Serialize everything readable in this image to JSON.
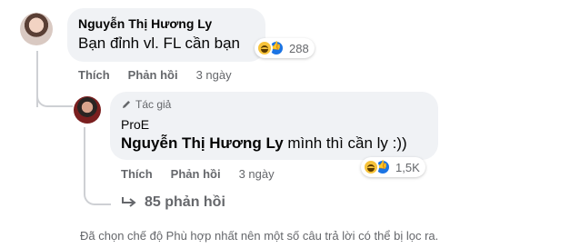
{
  "comment": {
    "author": "Nguyễn Thị Hương Ly",
    "text": "Bạn đỉnh vl. FL cần bạn",
    "reaction_count": "288",
    "actions": {
      "like": "Thích",
      "reply": "Phản hồi"
    },
    "time": "3 ngày"
  },
  "reply": {
    "badge": "Tác giả",
    "author": "ProE",
    "mention": "Nguyễn Thị Hương Ly",
    "text": " mình thì cần ly :))",
    "reaction_count": "1,5K",
    "actions": {
      "like": "Thích",
      "reply": "Phản hồi"
    },
    "time": "3 ngày"
  },
  "more_replies": {
    "label": "85 phản hồi"
  },
  "filter_note": "Đã chọn chế độ Phù hợp nhất nên một số câu trả lời có thể bị lọc ra.",
  "colors": {
    "bubble": "#f0f2f5",
    "muted": "#65676b",
    "like_blue": "#1b74e4",
    "haha_yellow": "#f7c33a"
  },
  "icons": [
    "pencil-icon",
    "reply-arrow-icon",
    "haha-reaction-icon",
    "like-reaction-icon"
  ]
}
